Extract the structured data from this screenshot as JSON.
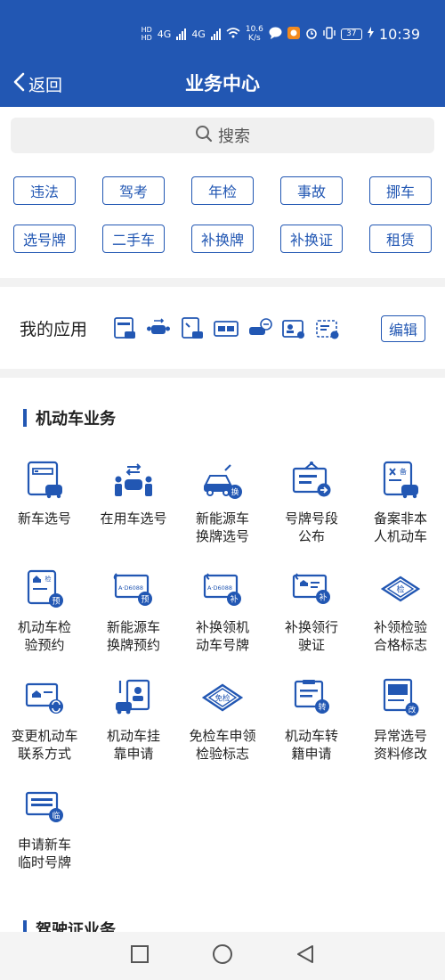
{
  "status_bar": {
    "speed_value": "10.6",
    "speed_unit": "K/s",
    "battery": "37",
    "time": "10:39",
    "net": "4G"
  },
  "header": {
    "back_label": "返回",
    "title": "业务中心"
  },
  "search": {
    "placeholder": "搜索"
  },
  "quick_tags": [
    "违法",
    "驾考",
    "年检",
    "事故",
    "挪车",
    "选号牌",
    "二手车",
    "补换牌",
    "补换证",
    "租赁"
  ],
  "my_apps": {
    "label": "我的应用",
    "edit_label": "编辑",
    "icons": [
      "new-car-plate-icon",
      "used-car-plate-icon",
      "record-vehicle-icon",
      "plate-segment-icon",
      "new-energy-plate-icon",
      "driver-license-icon",
      "inspection-label-icon"
    ]
  },
  "section_motor": {
    "title": "机动车业务",
    "items": [
      {
        "label": "新车选号",
        "icon": "new-car-plate-icon"
      },
      {
        "label": "在用车选号",
        "icon": "used-car-plate-icon"
      },
      {
        "label": "新能源车\n换牌选号",
        "icon": "new-energy-swap-icon",
        "badge": "换"
      },
      {
        "label": "号牌号段\n公布",
        "icon": "plate-segment-board-icon"
      },
      {
        "label": "备案非本\n人机动车",
        "icon": "record-vehicle-icon",
        "badge": "备"
      },
      {
        "label": "机动车检\n验预约",
        "icon": "inspection-booking-icon",
        "badge": "预"
      },
      {
        "label": "新能源车\n换牌预约",
        "icon": "new-energy-booking-icon",
        "badge": "预",
        "plate_text": "A·D6088"
      },
      {
        "label": "补换领机\n动车号牌",
        "icon": "replace-plate-icon",
        "badge": "补",
        "plate_text": "A·D6088"
      },
      {
        "label": "补换领行\n驶证",
        "icon": "replace-license-icon",
        "badge": "补"
      },
      {
        "label": "补领检验\n合格标志",
        "icon": "inspection-label-icon",
        "badge": "检"
      },
      {
        "label": "变更机动车\n联系方式",
        "icon": "change-contact-icon"
      },
      {
        "label": "机动车挂\n靠申请",
        "icon": "affiliation-icon"
      },
      {
        "label": "免检车申领\n检验标志",
        "icon": "exempt-label-icon",
        "badge": "免检"
      },
      {
        "label": "机动车转\n籍申请",
        "icon": "transfer-icon",
        "badge": "转"
      },
      {
        "label": "异常选号\n资料修改",
        "icon": "abnormal-edit-icon",
        "badge": "改"
      },
      {
        "label": "申请新车\n临时号牌",
        "icon": "temp-plate-icon",
        "badge": "临"
      }
    ]
  },
  "section_driver": {
    "title": "驾驶证业务"
  },
  "colors": {
    "primary": "#2257b3",
    "background": "#f2f2f2",
    "surface": "#ffffff",
    "text": "#222222"
  }
}
